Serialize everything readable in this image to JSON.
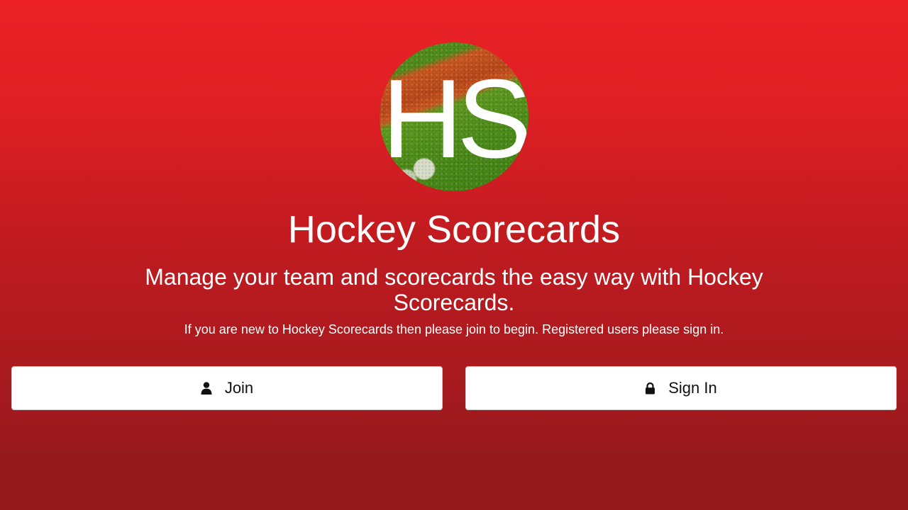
{
  "logo": {
    "text": "HS"
  },
  "header": {
    "title": "Hockey Scorecards",
    "tagline": "Manage your team and scorecards the easy way with Hockey Scorecards.",
    "subtext": "If you are new to Hockey Scorecards then please join to begin. Registered users please sign in."
  },
  "actions": {
    "join_label": "Join",
    "join_icon": "user-icon",
    "signin_label": "Sign In",
    "signin_icon": "lock-icon"
  },
  "colors": {
    "hero_top": "#ec2226",
    "hero_bottom": "#9a191d",
    "page_background": "#951a1e",
    "button_background": "#ffffff",
    "text_light": "#ffffff"
  }
}
